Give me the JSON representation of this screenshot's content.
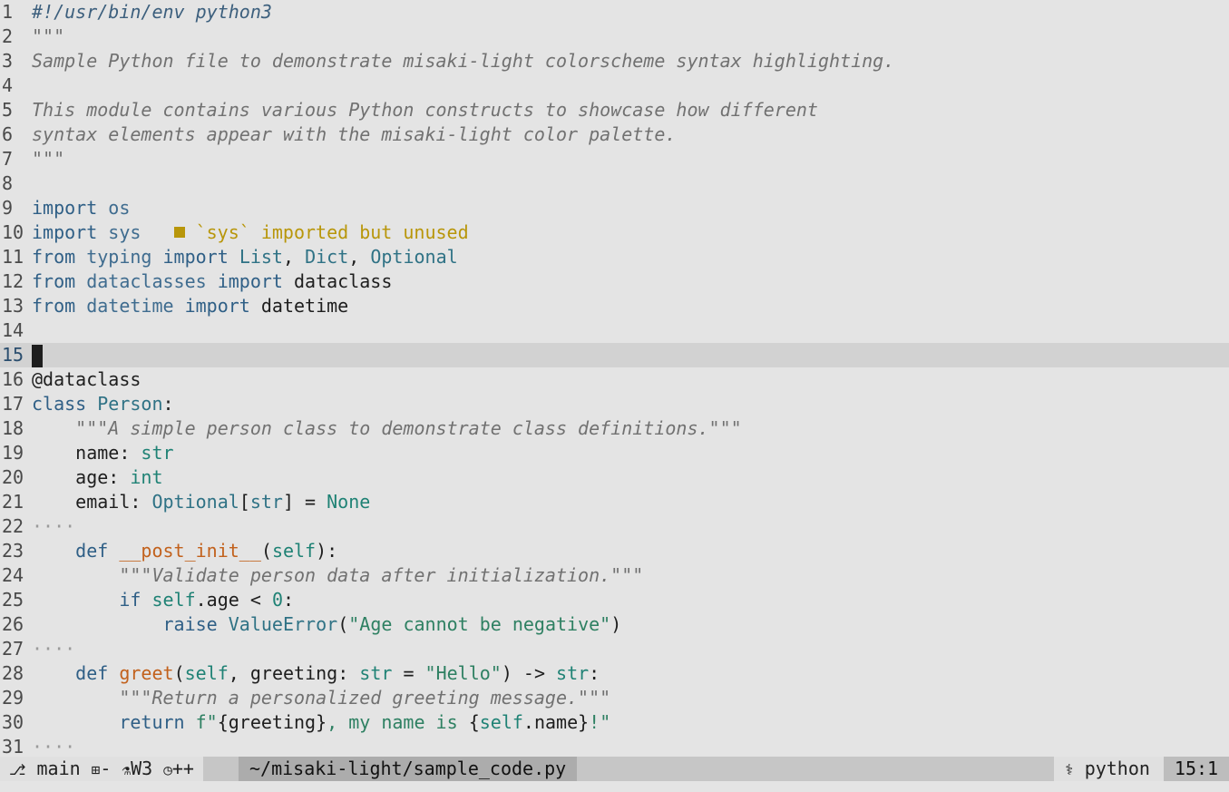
{
  "editor": {
    "current_line": 15,
    "lines": [
      {
        "n": "1",
        "tokens": [
          {
            "t": "#!/usr/bin/env python3",
            "c": "shebang"
          }
        ]
      },
      {
        "n": "2",
        "tokens": [
          {
            "t": "\"\"\"",
            "c": "doc"
          }
        ]
      },
      {
        "n": "3",
        "tokens": [
          {
            "t": "Sample Python file to demonstrate misaki-light colorscheme syntax highlighting.",
            "c": "doc"
          }
        ]
      },
      {
        "n": "4",
        "tokens": []
      },
      {
        "n": "5",
        "tokens": [
          {
            "t": "This module contains various Python constructs to showcase how different",
            "c": "doc"
          }
        ]
      },
      {
        "n": "6",
        "tokens": [
          {
            "t": "syntax elements appear with the misaki-light color palette.",
            "c": "doc"
          }
        ]
      },
      {
        "n": "7",
        "tokens": [
          {
            "t": "\"\"\"",
            "c": "doc"
          }
        ]
      },
      {
        "n": "8",
        "tokens": []
      },
      {
        "n": "9",
        "tokens": [
          {
            "t": "import",
            "c": "kw"
          },
          {
            "t": " "
          },
          {
            "t": "os",
            "c": "mod"
          }
        ]
      },
      {
        "n": "10",
        "tokens": [
          {
            "t": "import",
            "c": "kw"
          },
          {
            "t": " "
          },
          {
            "t": "sys",
            "c": "mod"
          }
        ],
        "diagnostic": "`sys` imported but unused"
      },
      {
        "n": "11",
        "tokens": [
          {
            "t": "from",
            "c": "kw"
          },
          {
            "t": " "
          },
          {
            "t": "typing",
            "c": "mod"
          },
          {
            "t": " "
          },
          {
            "t": "import",
            "c": "kw"
          },
          {
            "t": " "
          },
          {
            "t": "List",
            "c": "ty"
          },
          {
            "t": ", "
          },
          {
            "t": "Dict",
            "c": "ty"
          },
          {
            "t": ", "
          },
          {
            "t": "Optional",
            "c": "ty"
          }
        ]
      },
      {
        "n": "12",
        "tokens": [
          {
            "t": "from",
            "c": "kw"
          },
          {
            "t": " "
          },
          {
            "t": "dataclasses",
            "c": "mod"
          },
          {
            "t": " "
          },
          {
            "t": "import",
            "c": "kw"
          },
          {
            "t": " dataclass"
          }
        ]
      },
      {
        "n": "13",
        "tokens": [
          {
            "t": "from",
            "c": "kw"
          },
          {
            "t": " "
          },
          {
            "t": "datetime",
            "c": "mod"
          },
          {
            "t": " "
          },
          {
            "t": "import",
            "c": "kw"
          },
          {
            "t": " datetime"
          }
        ]
      },
      {
        "n": "14",
        "tokens": []
      },
      {
        "n": "15",
        "tokens": [],
        "cursor": true
      },
      {
        "n": "16",
        "tokens": [
          {
            "t": "@dataclass"
          }
        ]
      },
      {
        "n": "17",
        "tokens": [
          {
            "t": "class",
            "c": "kw"
          },
          {
            "t": " "
          },
          {
            "t": "Person",
            "c": "ty"
          },
          {
            "t": ":"
          }
        ]
      },
      {
        "n": "18",
        "tokens": [
          {
            "t": "    "
          },
          {
            "t": "\"\"\"A simple person class to demonstrate class definitions.\"\"\"",
            "c": "doc"
          }
        ]
      },
      {
        "n": "19",
        "tokens": [
          {
            "t": "    name: "
          },
          {
            "t": "str",
            "c": "bi"
          }
        ]
      },
      {
        "n": "20",
        "tokens": [
          {
            "t": "    age: "
          },
          {
            "t": "int",
            "c": "bi"
          }
        ]
      },
      {
        "n": "21",
        "tokens": [
          {
            "t": "    email: "
          },
          {
            "t": "Optional",
            "c": "ty"
          },
          {
            "t": "["
          },
          {
            "t": "str",
            "c": "ty"
          },
          {
            "t": "] = "
          },
          {
            "t": "None",
            "c": "bi"
          }
        ]
      },
      {
        "n": "22",
        "tokens": [
          {
            "t": "····",
            "c": "ws"
          }
        ]
      },
      {
        "n": "23",
        "tokens": [
          {
            "t": "    "
          },
          {
            "t": "def",
            "c": "kw"
          },
          {
            "t": " "
          },
          {
            "t": "__post_init__",
            "c": "fn"
          },
          {
            "t": "("
          },
          {
            "t": "self",
            "c": "bi"
          },
          {
            "t": "):"
          }
        ]
      },
      {
        "n": "24",
        "tokens": [
          {
            "t": "        "
          },
          {
            "t": "\"\"\"Validate person data after initialization.\"\"\"",
            "c": "doc"
          }
        ]
      },
      {
        "n": "25",
        "tokens": [
          {
            "t": "        "
          },
          {
            "t": "if",
            "c": "kw"
          },
          {
            "t": " "
          },
          {
            "t": "self",
            "c": "bi"
          },
          {
            "t": ".age < "
          },
          {
            "t": "0",
            "c": "num"
          },
          {
            "t": ":"
          }
        ]
      },
      {
        "n": "26",
        "tokens": [
          {
            "t": "            "
          },
          {
            "t": "raise",
            "c": "kw"
          },
          {
            "t": " "
          },
          {
            "t": "ValueError",
            "c": "ty"
          },
          {
            "t": "("
          },
          {
            "t": "\"Age cannot be negative\"",
            "c": "str"
          },
          {
            "t": ")"
          }
        ]
      },
      {
        "n": "27",
        "tokens": [
          {
            "t": "····",
            "c": "ws"
          }
        ]
      },
      {
        "n": "28",
        "tokens": [
          {
            "t": "    "
          },
          {
            "t": "def",
            "c": "kw"
          },
          {
            "t": " "
          },
          {
            "t": "greet",
            "c": "fn"
          },
          {
            "t": "("
          },
          {
            "t": "self",
            "c": "bi"
          },
          {
            "t": ", greeting: "
          },
          {
            "t": "str",
            "c": "bi"
          },
          {
            "t": " = "
          },
          {
            "t": "\"Hello\"",
            "c": "str"
          },
          {
            "t": ") -> "
          },
          {
            "t": "str",
            "c": "bi"
          },
          {
            "t": ":"
          }
        ]
      },
      {
        "n": "29",
        "tokens": [
          {
            "t": "        "
          },
          {
            "t": "\"\"\"Return a personalized greeting message.\"\"\"",
            "c": "doc"
          }
        ]
      },
      {
        "n": "30",
        "tokens": [
          {
            "t": "        "
          },
          {
            "t": "return",
            "c": "kw"
          },
          {
            "t": " "
          },
          {
            "t": "f\"",
            "c": "str"
          },
          {
            "t": "{greeting}"
          },
          {
            "t": ", my name is ",
            "c": "str"
          },
          {
            "t": "{"
          },
          {
            "t": "self",
            "c": "bi"
          },
          {
            "t": ".name}"
          },
          {
            "t": "!\"",
            "c": "str"
          }
        ]
      },
      {
        "n": "31",
        "tokens": [
          {
            "t": "····",
            "c": "ws"
          }
        ]
      }
    ]
  },
  "statusbar": {
    "branch_icon": "git-branch-icon",
    "branch": "main",
    "diff_icon": "diff-icon",
    "diff_value": "-",
    "flask_icon": "flask-icon",
    "warnings": "W3",
    "clock_icon": "clock-icon",
    "clock_value": "++",
    "file_path": "~/misaki-light/sample_code.py",
    "python_icon": "python-icon",
    "filetype": "python",
    "position": "15:1"
  }
}
